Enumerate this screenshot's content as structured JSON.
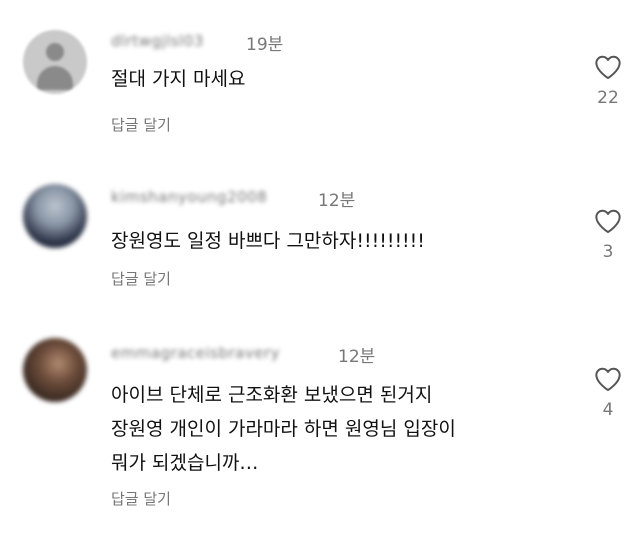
{
  "comments": [
    {
      "username": "dlrtwgjlsl03",
      "time": "19분",
      "text": "절대 가지 마세요",
      "reply_label": "답글 달기",
      "likes": "22"
    },
    {
      "username": "kimshanyoung2008",
      "time": "12분",
      "text": "장원영도 일정 바쁘다 그만하자!!!!!!!!!",
      "reply_label": "답글 달기",
      "likes": "3"
    },
    {
      "username": "emmagraceisbravery",
      "time": "12분",
      "text": "아이브 단체로 근조화환 보냈으면 된거지\n장원영 개인이 가라마라 하면 원영님 입장이\n뭐가 되겠습니까…",
      "reply_label": "답글 달기",
      "likes": "4"
    }
  ],
  "colors": {
    "text": "#111111",
    "muted": "#777777",
    "background": "#ffffff"
  },
  "icons": {
    "like": "heart-outline-icon",
    "default_avatar": "user-silhouette-icon"
  }
}
